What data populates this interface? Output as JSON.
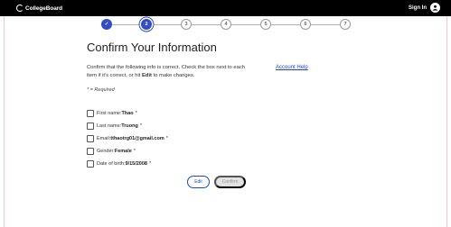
{
  "header": {
    "logo_text": "CollegeBoard",
    "sign_in_label": "Sign In"
  },
  "stepper": {
    "steps": [
      {
        "label": "✓",
        "state": "done"
      },
      {
        "label": "2",
        "state": "current"
      },
      {
        "label": "3",
        "state": "todo"
      },
      {
        "label": "4",
        "state": "todo"
      },
      {
        "label": "5",
        "state": "todo"
      },
      {
        "label": "6",
        "state": "todo"
      },
      {
        "label": "7",
        "state": "todo"
      }
    ]
  },
  "main": {
    "title": "Confirm Your Information",
    "intro_part1": "Confirm that the following info is correct. Check the box next to each item if it's correct, or hit ",
    "intro_bold": "Edit",
    "intro_part2": " to make changes.",
    "account_help": "Account Help",
    "required_note": "* = Required"
  },
  "fields": [
    {
      "label": "First name:",
      "value": "Thao",
      "required": "*"
    },
    {
      "label": "Last name:",
      "value": "Truong",
      "required": "*"
    },
    {
      "label": "Email:",
      "value": "tthaotrg01@gmail.com",
      "required": "*"
    },
    {
      "label": "Gender:",
      "value": "Female",
      "required": "*"
    },
    {
      "label": "Date of birth:",
      "value": "9/15/2008",
      "required": "*"
    }
  ],
  "actions": {
    "edit_label": "Edit",
    "confirm_label": "Confirm"
  },
  "colors": {
    "accent": "#324dc7",
    "link": "#1a48c4",
    "header_bg": "#000000"
  }
}
